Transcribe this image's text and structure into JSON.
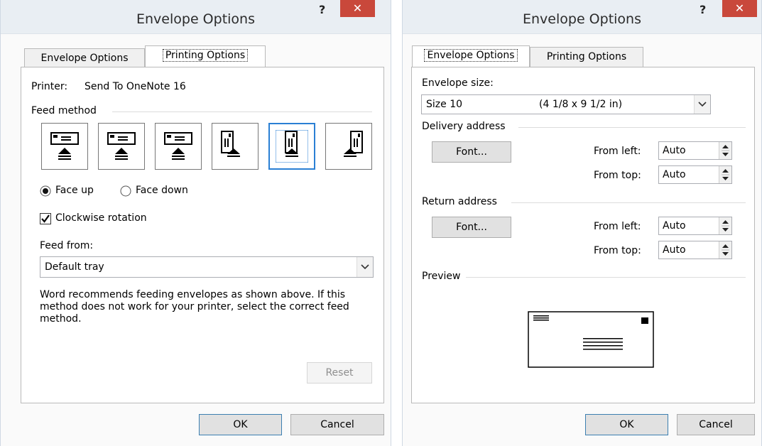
{
  "left": {
    "title": "Envelope Options",
    "help": "?",
    "close": "✕",
    "tabs": {
      "envelope": "Envelope Options",
      "printing": "Printing Options"
    },
    "printer_label": "Printer:",
    "printer_name": "Send To OneNote 16",
    "feed_method": "Feed method",
    "face_up": "Face up",
    "face_down": "Face down",
    "clockwise": "Clockwise rotation",
    "feed_from_label": "Feed from:",
    "feed_from_value": "Default tray",
    "recommend": "Word recommends feeding envelopes as shown above. If this method does not work for your printer, select the correct feed method.",
    "reset": "Reset",
    "ok": "OK",
    "cancel": "Cancel"
  },
  "right": {
    "title": "Envelope Options",
    "help": "?",
    "close": "✕",
    "tabs": {
      "envelope": "Envelope Options",
      "printing": "Printing Options"
    },
    "envelope_size_label": "Envelope size:",
    "envelope_size_name": "Size 10",
    "envelope_size_dims": "(4 1/8 x 9 1/2 in)",
    "delivery_address": "Delivery address",
    "return_address": "Return address",
    "font_button": "Font...",
    "from_left": "From left:",
    "from_top": "From top:",
    "delivery_left": "Auto",
    "delivery_top": "Auto",
    "return_left": "Auto",
    "return_top": "Auto",
    "preview": "Preview",
    "ok": "OK",
    "cancel": "Cancel"
  },
  "colors": {
    "accent": "#2a7fd4",
    "close": "#c9483b",
    "titlebar": "#e9eef3"
  }
}
